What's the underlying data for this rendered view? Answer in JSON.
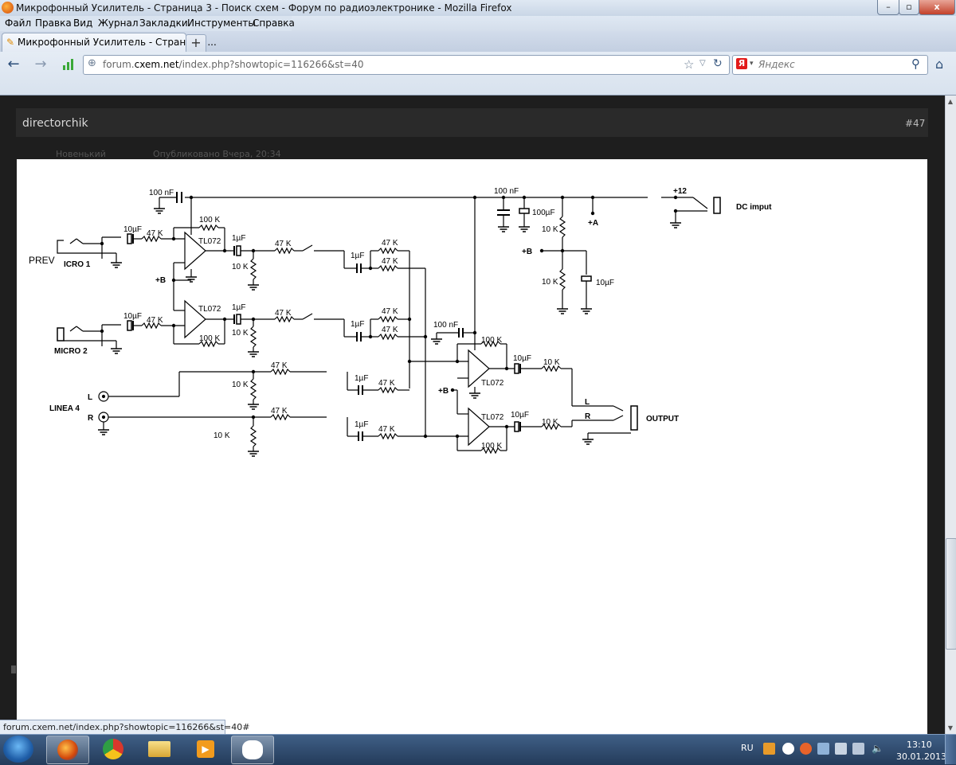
{
  "window": {
    "title": "Микрофонный Усилитель - Страница 3 - Поиск схем - Форум по радиоэлектронике - Mozilla Firefox",
    "minimize": "–",
    "maximize": "▫",
    "close": "x"
  },
  "menu": {
    "items": [
      {
        "label": "Файл"
      },
      {
        "label": "Правка"
      },
      {
        "label": "Вид"
      },
      {
        "label": "Журнал"
      },
      {
        "label": "Закладки"
      },
      {
        "label": "Инструменты"
      },
      {
        "label": "Справка"
      }
    ]
  },
  "tabs": {
    "active_label": "Микрофонный Усилитель - Страница ...",
    "new_tab": "+"
  },
  "nav": {
    "back": "←",
    "forward": "→",
    "url_domain_prefix": "forum.",
    "url_domain": "cxem.net",
    "url_path": "/index.php?showtopic=116266&st=40",
    "search_placeholder": "Яндекс",
    "search_engine_logo": "Я"
  },
  "post": {
    "author": "directorchik",
    "number": "#47",
    "rank": "Новенький",
    "published": "Опубликовано Вчера, 20:34"
  },
  "schematic": {
    "labels": {
      "c_top": "100 nF",
      "c_top_right": "100 nF",
      "c_100u": "100µF",
      "plus12": "+12",
      "dc_input": "DC imput",
      "plus_a": "+A",
      "r10k_a": "10 K",
      "plus_b_right": "+B",
      "r10k_b": "10 K",
      "c10u_right": "10µF",
      "prev": "PREV",
      "micro1": "ICRO 1",
      "micro2": "MICRO 2",
      "c10u_1": "10µF",
      "r47k_in1": "47 K",
      "r100k_1": "100 K",
      "tl072_1": "TL072",
      "c1u_1": "1µF",
      "r10k_1": "10 K",
      "r47k_mid1": "47 K",
      "c1u_mix1": "1µF",
      "r47k_mix1a": "47 K",
      "r47k_mix1b": "47 K",
      "plus_b_left": "+B",
      "c10u_2": "10µF",
      "r47k_in2": "47 K",
      "r100k_2": "100 K",
      "tl072_2": "TL072",
      "c1u_2": "1µF",
      "r10k_2": "10 K",
      "r47k_mid2": "47 K",
      "c1u_mix2": "1µF",
      "r47k_mix2a": "47 K",
      "r47k_mix2b": "47 K",
      "c_mix": "100 nF",
      "r100k_3": "100 K",
      "c10u_3": "10µF",
      "r10k_out1": "10 K",
      "plus_b_mid": "+B",
      "tl072_3": "TL072",
      "tl072_4": "TL072",
      "c10u_4": "10µF",
      "r10k_out2": "10 K",
      "r100k_4": "100 K",
      "out_l": "L",
      "out_r": "R",
      "output": "OUTPUT",
      "r47k_line_l": "47 K",
      "r10k_line_l": "10 K",
      "c1u_line_l": "1µF",
      "r47k_line_l2": "47 K",
      "line_l": "L",
      "line_r": "R",
      "linea": "LINEA 4",
      "r47k_line_r": "47 K",
      "r10k_line_r": "10 K",
      "c1u_line_r": "1µF",
      "r47k_line_r2": "47 K"
    }
  },
  "status": {
    "link": "forum.cxem.net/index.php?showtopic=116266&st=40#"
  },
  "taskbar": {
    "lang": "RU",
    "time": "13:10",
    "date": "30.01.2013"
  }
}
